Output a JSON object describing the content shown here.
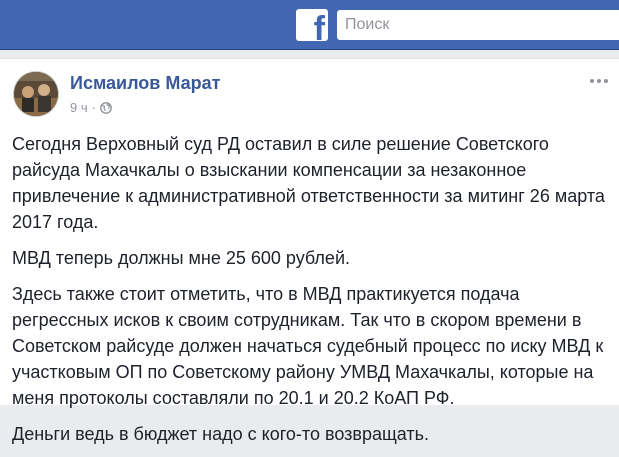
{
  "header": {
    "logo_letter": "f",
    "search_placeholder": "Поиск",
    "brand_color": "#4267b2"
  },
  "post": {
    "author": "Исмаилов Марат",
    "time": "9 ч",
    "separator": "·",
    "privacy_icon": "globe-icon",
    "menu_icon": "more-options-icon",
    "paragraphs": [
      "Сегодня Верховный суд РД оставил в силе решение Советского райсуда Махачкалы о взыскании компенсации за незаконное привлечение к административной ответственности за митинг 26 марта 2017 года.",
      "МВД теперь должны мне 25 600 рублей.",
      "Здесь также стоит отметить, что в МВД практикуется подача регрессных исков к своим сотрудникам. Так что в скором времени в Советском райсуде должен начаться судебный процесс по иску МВД к участковым ОП по Советскому району УМВД Махачкалы, которые на меня протоколы составляли по 20.1 и 20.2 КоАП РФ.",
      "Деньги ведь в бюджет надо с кого-то возвращать."
    ]
  }
}
